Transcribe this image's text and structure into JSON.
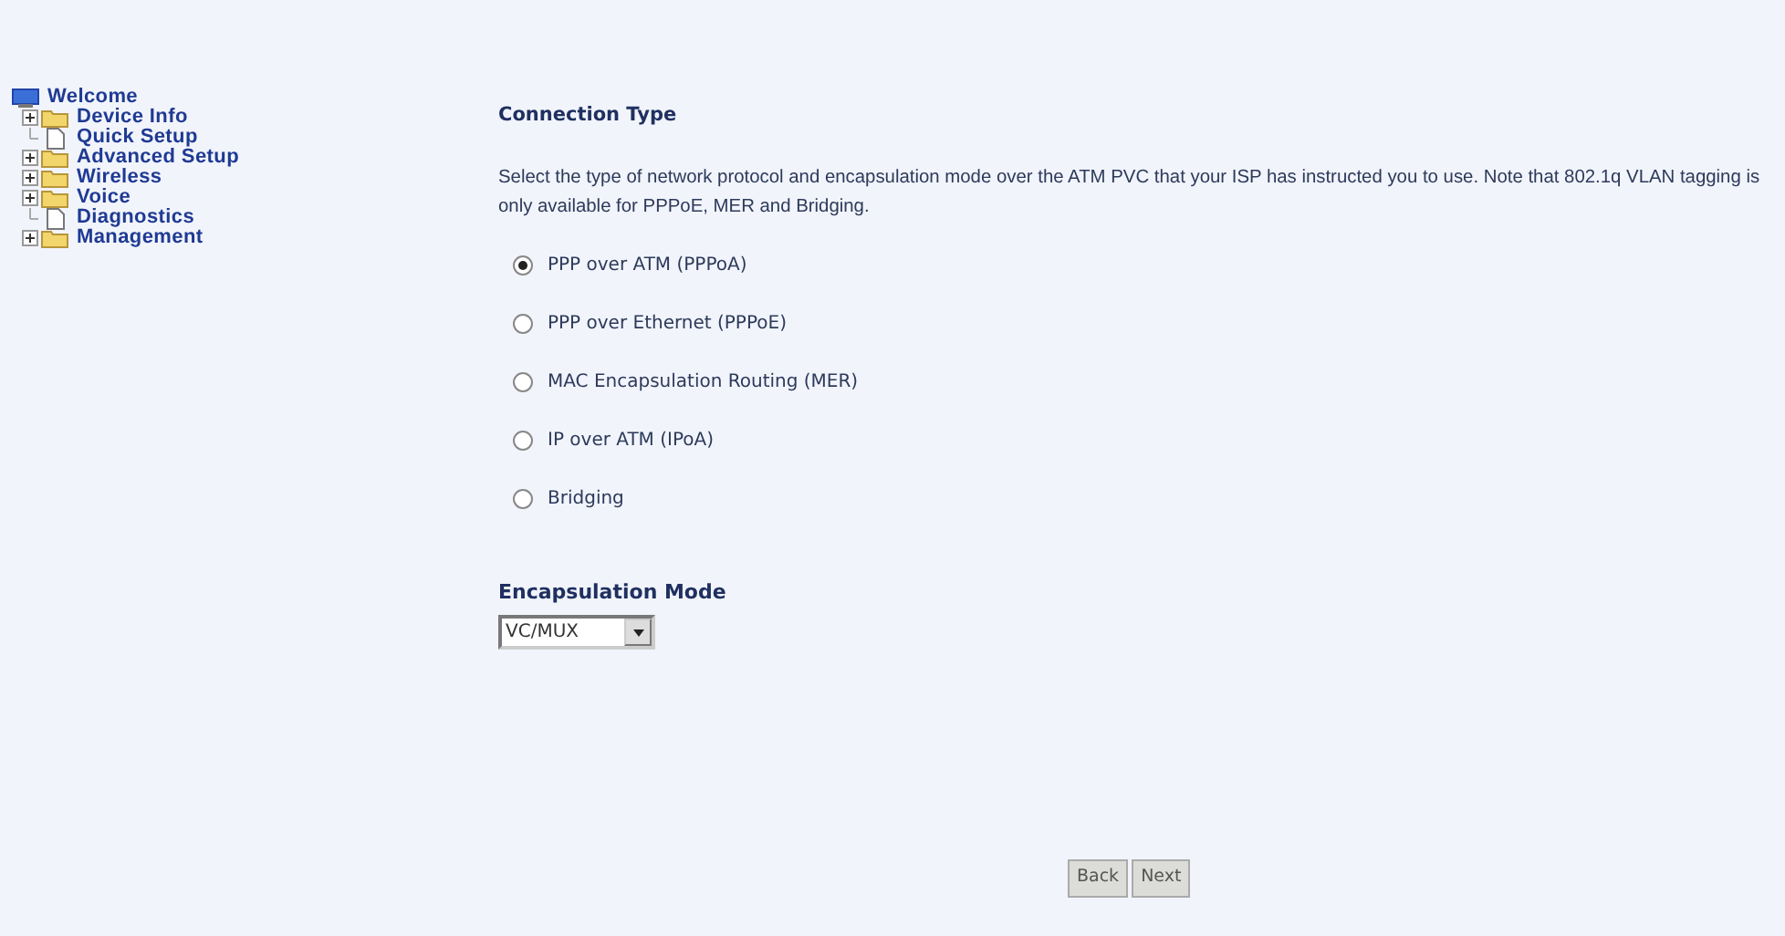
{
  "sidebar": {
    "root": {
      "label": "Welcome",
      "children": [
        {
          "label": "Device Info",
          "kind": "folder",
          "expanded": false
        },
        {
          "label": "Quick Setup",
          "kind": "page"
        },
        {
          "label": "Advanced Setup",
          "kind": "folder",
          "expanded": false
        },
        {
          "label": "Wireless",
          "kind": "folder",
          "expanded": false
        },
        {
          "label": "Voice",
          "kind": "folder",
          "expanded": false
        },
        {
          "label": "Diagnostics",
          "kind": "page"
        },
        {
          "label": "Management",
          "kind": "folder",
          "expanded": false
        }
      ]
    }
  },
  "main": {
    "title": "Connection Type",
    "description": "Select the type of network protocol and encapsulation mode over the ATM PVC that your ISP has instructed you to use. Note that 802.1q VLAN tagging is only available for PPPoE, MER and Bridging.",
    "options": [
      {
        "label": "PPP over ATM (PPPoA)",
        "selected": true
      },
      {
        "label": "PPP over Ethernet (PPPoE)",
        "selected": false
      },
      {
        "label": "MAC Encapsulation Routing (MER)",
        "selected": false
      },
      {
        "label": "IP over ATM (IPoA)",
        "selected": false
      },
      {
        "label": "Bridging",
        "selected": false
      }
    ],
    "encapsulation": {
      "label": "Encapsulation Mode",
      "value": "VC/MUX"
    },
    "buttons": [
      "Back",
      "Next"
    ]
  }
}
